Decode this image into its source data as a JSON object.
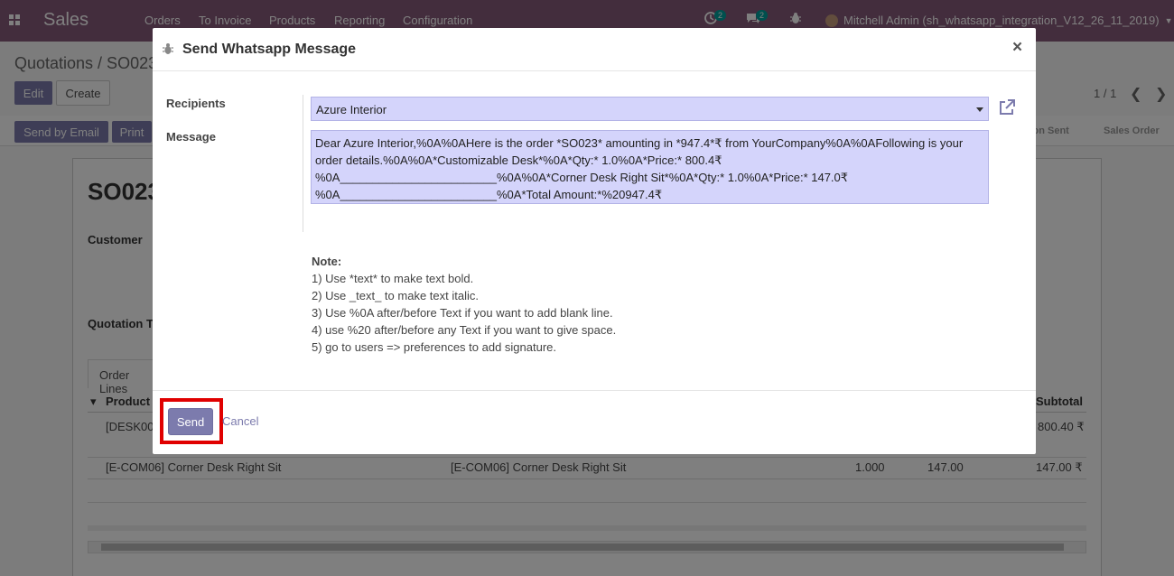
{
  "navbar": {
    "brand": "Sales",
    "menu": [
      "Orders",
      "To Invoice",
      "Products",
      "Reporting",
      "Configuration"
    ],
    "activity_count": "2",
    "messages_count": "2",
    "user": "Mitchell Admin (sh_whatsapp_integration_V12_26_11_2019)"
  },
  "background": {
    "breadcrumb": "Quotations / SO023",
    "edit_label": "Edit",
    "create_label": "Create",
    "pager": "1 / 1",
    "send_email_label": "Send by Email",
    "print_label": "Print",
    "stages": [
      "Quotation Sent",
      "Sales Order"
    ],
    "record_title": "SO023",
    "customer_label": "Customer",
    "quotation_template_label": "Quotation Te",
    "order_lines_tab": "Order Lines",
    "col_product": "Product",
    "col_subtotal": "Subtotal",
    "row1": {
      "product": "[DESK00",
      "subtotal": "800.40 ₹"
    },
    "row2": {
      "product": "[E-COM06] Corner Desk Right Sit",
      "description": "[E-COM06] Corner Desk Right Sit",
      "qty": "1.000",
      "price": "147.00",
      "subtotal": "147.00 ₹"
    }
  },
  "modal": {
    "title": "Send Whatsapp Message",
    "recipients_label": "Recipients",
    "recipients_value": "Azure Interior",
    "message_label": "Message",
    "message_value": "Dear Azure Interior,%0A%0AHere is the order *SO023* amounting in *947.4*₹ from YourCompany%0A%0AFollowing is your order details.%0A%0A*Customizable Desk*%0A*Qty:* 1.0%0A*Price:* 800.4₹\n%0A________________________%0A%0A*Corner Desk Right Sit*%0A*Qty:* 1.0%0A*Price:* 147.0₹\n%0A________________________%0A*Total Amount:*%20947.4₹",
    "note_title": "Note:",
    "notes": [
      "1) Use *text* to make text bold.",
      "2) Use _text_ to make text italic.",
      "3) Use %0A after/before Text if you want to add blank line.",
      "4) use %20 after/before any Text if you want to give space.",
      "5) go to users => preferences to add signature."
    ],
    "send_label": "Send",
    "cancel_label": "Cancel"
  },
  "colors": {
    "navbar": "#875a7b",
    "primary": "#7c7bad",
    "field_bg": "#d4d4fb",
    "highlight": "#e00000"
  }
}
